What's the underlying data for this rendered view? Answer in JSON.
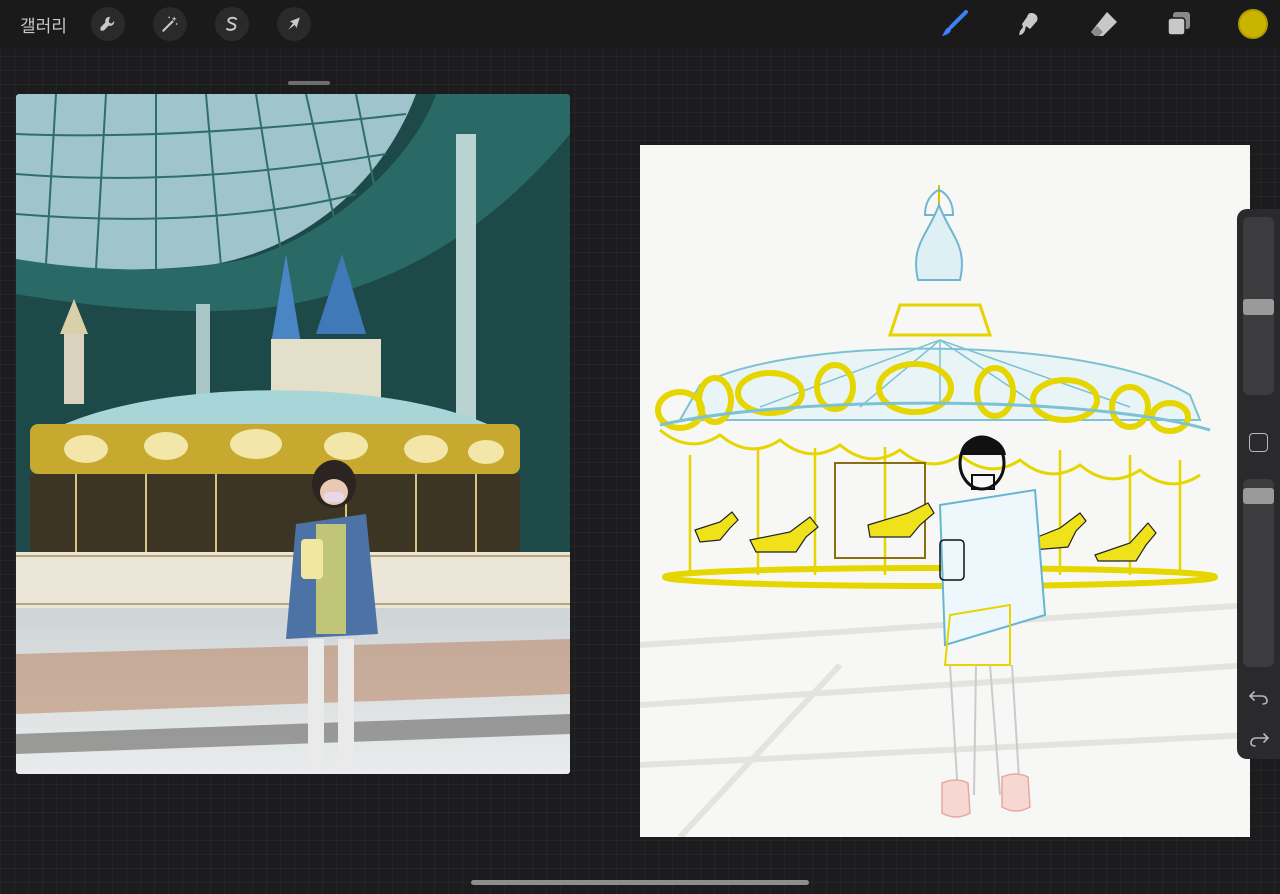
{
  "app": {
    "gallery_label": "갤러리"
  },
  "toolbar": {
    "left_tools": [
      "wrench-icon",
      "magic-wand-icon",
      "selection-s-icon",
      "transform-arrow-icon"
    ],
    "right_tools": [
      "brush-icon",
      "smudge-icon",
      "eraser-icon",
      "layers-icon"
    ],
    "active_tool": "brush-icon",
    "active_color": "#c9b400",
    "accent": "#3b82f6"
  },
  "reference": {
    "description_icon": "photo-reference"
  },
  "canvas": {
    "background": "#f7f7f5"
  },
  "sidebar": {
    "brush_size_level": 0.2,
    "opacity_level": 0.05
  }
}
